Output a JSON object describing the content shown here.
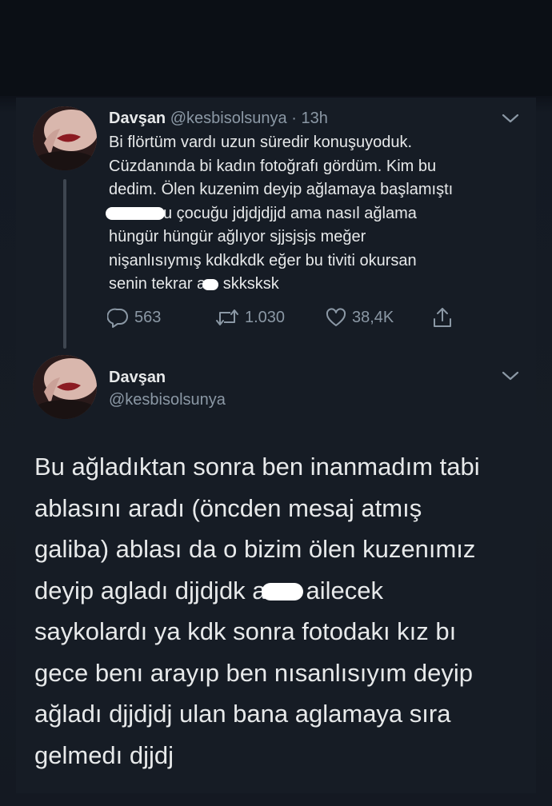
{
  "tweet1": {
    "display_name": "Davşan",
    "handle": "@kesbisolsunya",
    "separator": "·",
    "time": "13h",
    "lines": [
      "Bi flörtüm vardı uzun süredir konuşuyoduk.",
      "Cüzdanında bi kadın fotoğrafı gördüm. Kim bu",
      "dedim. Ölen kuzenim deyip ağlamaya başlamıştı",
      "u çocuğu jdjdjdjjd ama nasıl ağlama",
      "hüngür hüngür ağlıyor sjjsjsjs meğer",
      "nişanlısıymış kdkdkdk eğer bu tiviti okursan",
      "senin tekrar a",
      " skksksk"
    ],
    "actions": {
      "replies": "563",
      "retweets": "1.030",
      "likes": "38,4K"
    }
  },
  "tweet2": {
    "display_name": "Davşan",
    "handle": "@kesbisolsunya",
    "lines": [
      "Bu ağladıktan sonra ben inanmadım tabi",
      "ablasını aradı (öncden mesaj atmış",
      "galiba) ablası da o bizim ölen kuzenımız",
      "deyip agladı djjdjdk a",
      "ailecek",
      "saykolardı ya kdk sonra fotodakı kız bı",
      "gece benı arayıp ben nısanlısıyım deyip",
      "ağladı djjdjdj ulan bana aglamaya sıra",
      "gelmedı djjdj"
    ]
  },
  "icons": {
    "avatar": "profile-avatar",
    "more": "chevron-down-icon",
    "reply": "reply-icon",
    "retweet": "retweet-icon",
    "like": "heart-icon",
    "share": "share-icon"
  },
  "colors": {
    "background": "#161c25",
    "text": "#e7e9ea",
    "muted": "#8b98a5",
    "thread_line": "#3e4650"
  }
}
